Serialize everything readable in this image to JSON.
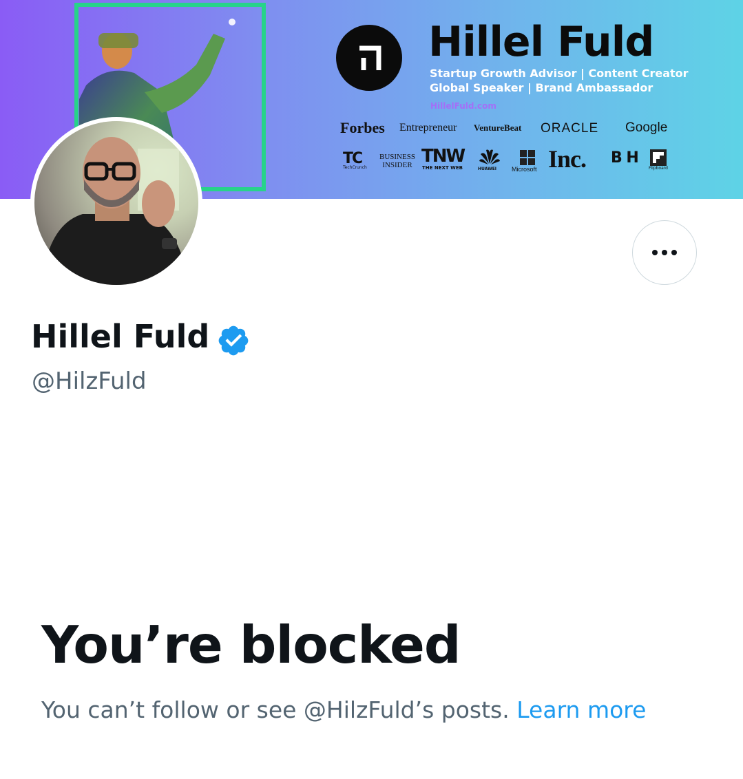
{
  "banner": {
    "title": "Hillel Fuld",
    "tagline_line1": "Startup Growth Advisor | Content Creator",
    "tagline_line2": "Global Speaker | Brand Ambassador",
    "url": "HillelFuld.com",
    "brands": {
      "forbes": "Forbes",
      "entrepreneur": "Entrepreneur",
      "venturebeat": "VentureBeat",
      "oracle": "ORACLE",
      "google": "Google",
      "techcrunch": "TC",
      "techcrunch_sub": "TechCrunch",
      "business_insider_1": "BUSINESS",
      "business_insider_2": "INSIDER",
      "tnw": "TNW",
      "tnw_sub": "THE NEXT WEB",
      "huawei": "HUAWEI",
      "microsoft": "Microsoft",
      "inc": "Inc.",
      "bh": "B H",
      "flipboard": "Flipboard"
    }
  },
  "profile": {
    "display_name": "Hillel Fuld",
    "handle": "@HilzFuld",
    "verified": true
  },
  "blocked": {
    "title": "You’re blocked",
    "description": "You can’t follow or see @HilzFuld’s posts.",
    "learn_more": "Learn more"
  },
  "colors": {
    "accent": "#1d9bf0",
    "secondary_text": "#536471",
    "primary_text": "#0f1419",
    "banner_frame": "#27d38a"
  }
}
